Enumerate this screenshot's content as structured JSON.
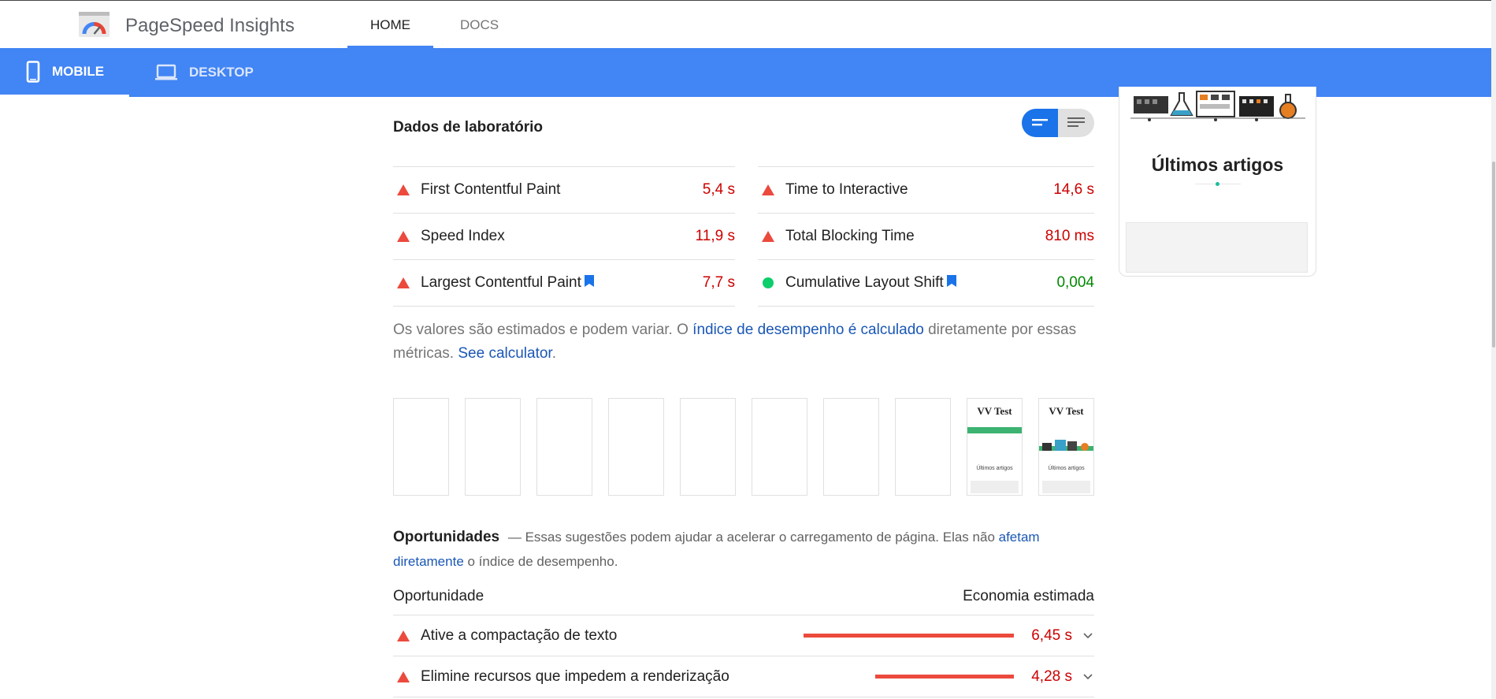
{
  "header": {
    "app_title": "PageSpeed Insights",
    "nav_tabs": [
      {
        "label": "HOME",
        "active": true
      },
      {
        "label": "DOCS",
        "active": false
      }
    ]
  },
  "device_tabs": [
    {
      "label": "MOBILE",
      "icon": "smartphone-icon",
      "active": true
    },
    {
      "label": "DESKTOP",
      "icon": "laptop-icon",
      "active": false
    }
  ],
  "preview": {
    "heading": "Últimos artigos"
  },
  "lab": {
    "title": "Dados de laboratório",
    "metrics": [
      {
        "label": "First Contentful Paint",
        "value": "5,4 s",
        "status": "bad",
        "bookmark": false
      },
      {
        "label": "Time to Interactive",
        "value": "14,6 s",
        "status": "bad",
        "bookmark": false
      },
      {
        "label": "Speed Index",
        "value": "11,9 s",
        "status": "bad",
        "bookmark": false
      },
      {
        "label": "Total Blocking Time",
        "value": "810 ms",
        "status": "bad",
        "bookmark": false
      },
      {
        "label": "Largest Contentful Paint",
        "value": "7,7 s",
        "status": "bad",
        "bookmark": true
      },
      {
        "label": "Cumulative Layout Shift",
        "value": "0,004",
        "status": "good",
        "bookmark": true
      }
    ],
    "disclaimer": {
      "text1": "Os valores são estimados e podem variar. O ",
      "link1": "índice de desempenho é calculado",
      "text2": " diretamente por essas métricas. ",
      "link2": "See calculator",
      "text3": "."
    }
  },
  "filmstrip": {
    "frame_title": "VV Test",
    "frame_subtitle": "Últimos artigos"
  },
  "opportunities": {
    "title": "Oportunidades",
    "desc1": "— Essas sugestões podem ajudar a acelerar o carregamento de página. Elas não ",
    "desc_link": "afetam diretamente",
    "desc2": " o índice de desempenho.",
    "col_left": "Oportunidade",
    "col_right": "Economia estimada",
    "rows": [
      {
        "label": "Ative a compactação de texto",
        "value": "6,45 s",
        "savings_fraction": 1.0
      },
      {
        "label": "Elimine recursos que impedem a renderização",
        "value": "4,28 s",
        "savings_fraction": 0.66
      }
    ]
  },
  "colors": {
    "brand_blue": "#4285f4",
    "fail_red": "#eb4a3d",
    "pass_green": "#0cce6b"
  }
}
